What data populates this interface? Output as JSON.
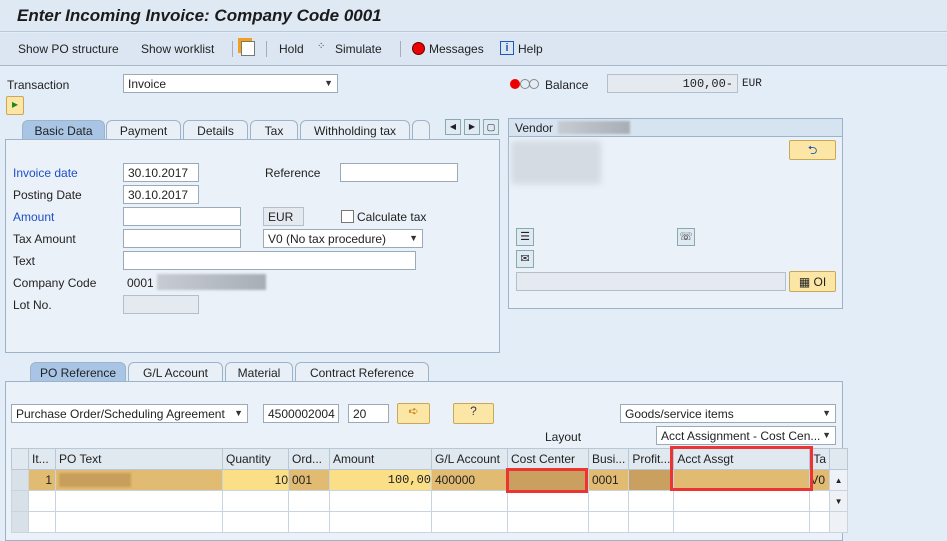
{
  "title": "Enter Incoming Invoice: Company Code 0001",
  "toolbar": {
    "show_po_structure": "Show PO structure",
    "show_worklist": "Show worklist",
    "hold": "Hold",
    "simulate": "Simulate",
    "messages": "Messages",
    "help": "Help"
  },
  "header": {
    "transaction_label": "Transaction",
    "transaction_value": "Invoice",
    "balance_label": "Balance",
    "balance_value": "100,00-",
    "balance_currency": "EUR",
    "status_color": "#e00000"
  },
  "tabs": [
    "Basic Data",
    "Payment",
    "Details",
    "Tax",
    "Withholding tax"
  ],
  "basic": {
    "invoice_date_label": "Invoice date",
    "invoice_date": "30.10.2017",
    "reference_label": "Reference",
    "reference": "",
    "posting_date_label": "Posting Date",
    "posting_date": "30.10.2017",
    "amount_label": "Amount",
    "amount": "",
    "currency": "EUR",
    "calc_tax_label": "Calculate tax",
    "calc_tax_checked": false,
    "tax_amount_label": "Tax Amount",
    "tax_amount": "",
    "tax_code": "V0 (No tax procedure)",
    "text_label": "Text",
    "text": "",
    "company_code_label": "Company Code",
    "company_code": "0001",
    "lot_label": "Lot No.",
    "lot": ""
  },
  "vendor": {
    "label": "Vendor",
    "oi_button": "OI"
  },
  "bottom_tabs": [
    "PO Reference",
    "G/L Account",
    "Material",
    "Contract Reference"
  ],
  "po": {
    "doc_type": "Purchase Order/Scheduling Agreement",
    "po_number": "4500002004",
    "item": "20",
    "item_type": "Goods/service items",
    "layout_label": "Layout",
    "layout": "Acct Assignment - Cost Cen..."
  },
  "table": {
    "columns": [
      "It...",
      "PO Text",
      "Quantity",
      "Ord...",
      "Amount",
      "G/L Account",
      "Cost Center",
      "Busi...",
      "Profit...",
      "Acct Assgt",
      "Ta"
    ],
    "rows": [
      {
        "item": "1",
        "po_text": "",
        "quantity": "10",
        "order_unit": "001",
        "amount": "100,00",
        "gl_account": "400000",
        "cost_center": "",
        "business_area": "0001",
        "profit_center": "",
        "acct_assgt": "",
        "tax": "V0"
      }
    ]
  },
  "highlight_color": "#e33333"
}
